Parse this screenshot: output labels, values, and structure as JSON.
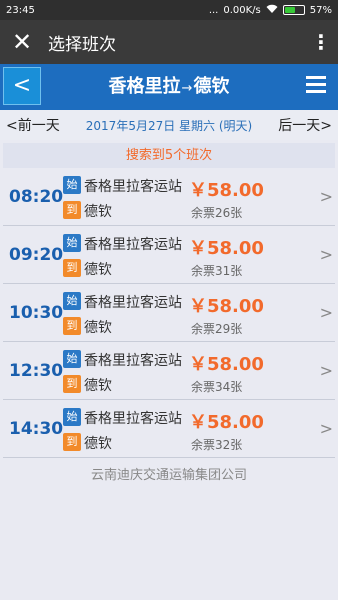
{
  "status": {
    "time": "23:45",
    "dots": "...",
    "speed": "0.00K/s",
    "battery": "57%",
    "battery_level": 0.57
  },
  "appbar": {
    "close_glyph": "✕",
    "title": "选择班次",
    "more_glyph": "⋮"
  },
  "header": {
    "back": "<",
    "origin": "香格里拉",
    "arrow": "→",
    "destination": "德钦"
  },
  "datenav": {
    "prev": "<前一天",
    "date": "2017年5月27日 星期六 (明天)",
    "next": "后一天>"
  },
  "search_count": "搜索到5个班次",
  "trips": [
    {
      "time": "08:20",
      "start_badge": "始",
      "end_badge": "到",
      "origin": "香格里拉客运站",
      "destination": "德钦",
      "price": "￥58.00",
      "seats": "余票26张",
      "chevron": ">"
    },
    {
      "time": "09:20",
      "start_badge": "始",
      "end_badge": "到",
      "origin": "香格里拉客运站",
      "destination": "德钦",
      "price": "￥58.00",
      "seats": "余票31张",
      "chevron": ">"
    },
    {
      "time": "10:30",
      "start_badge": "始",
      "end_badge": "到",
      "origin": "香格里拉客运站",
      "destination": "德钦",
      "price": "￥58.00",
      "seats": "余票29张",
      "chevron": ">"
    },
    {
      "time": "12:30",
      "start_badge": "始",
      "end_badge": "到",
      "origin": "香格里拉客运站",
      "destination": "德钦",
      "price": "￥58.00",
      "seats": "余票34张",
      "chevron": ">"
    },
    {
      "time": "14:30",
      "start_badge": "始",
      "end_badge": "到",
      "origin": "香格里拉客运站",
      "destination": "德钦",
      "price": "￥58.00",
      "seats": "余票32张",
      "chevron": ">"
    }
  ],
  "footer": "云南迪庆交通运输集团公司"
}
